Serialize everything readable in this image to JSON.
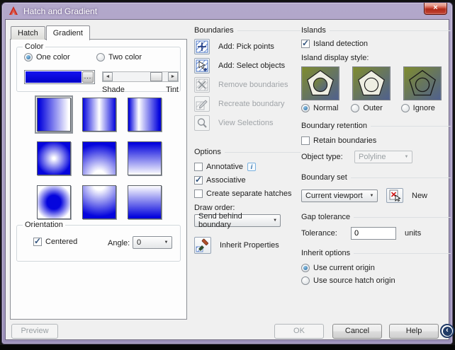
{
  "window": {
    "title": "Hatch and Gradient",
    "close_glyph": "×"
  },
  "tabs": {
    "hatch": "Hatch",
    "gradient": "Gradient"
  },
  "color": {
    "group_title": "Color",
    "one_color_label": "One color",
    "two_color_label": "Two color",
    "swatch_color": "#0a0ae0",
    "browse_label": "...",
    "shade_label": "Shade",
    "tint_label": "Tint"
  },
  "swatches": {
    "selected": "linear",
    "items": [
      {
        "name": "linear"
      },
      {
        "name": "cylinder"
      },
      {
        "name": "inverted-cylinder"
      },
      {
        "name": "spherical"
      },
      {
        "name": "hemispherical"
      },
      {
        "name": "curved"
      },
      {
        "name": "inverted-spherical"
      },
      {
        "name": "inverted-hemispherical"
      },
      {
        "name": "inverted-curved"
      }
    ]
  },
  "orientation": {
    "group_title": "Orientation",
    "centered_label": "Centered",
    "centered_checked": true,
    "angle_label": "Angle:",
    "angle_value": "0"
  },
  "preview": {
    "label": "Preview",
    "enabled": false
  },
  "boundaries": {
    "title": "Boundaries",
    "buttons": [
      {
        "label": "Add: Pick points",
        "enabled": true
      },
      {
        "label": "Add: Select objects",
        "enabled": true
      },
      {
        "label": "Remove boundaries",
        "enabled": false
      },
      {
        "label": "Recreate boundary",
        "enabled": false
      },
      {
        "label": "View Selections",
        "enabled": false
      }
    ]
  },
  "options": {
    "title": "Options",
    "annotative_label": "Annotative",
    "annotative_checked": false,
    "info_glyph": "i",
    "associative_label": "Associative",
    "associative_checked": true,
    "separate_label": "Create separate hatches",
    "separate_checked": false,
    "draw_order_label": "Draw order:",
    "draw_order_value": "Send behind boundary",
    "inherit_label": "Inherit Properties"
  },
  "islands": {
    "title": "Islands",
    "detection_label": "Island detection",
    "detection_checked": true,
    "display_style_label": "Island display style:",
    "styles": [
      {
        "label": "Normal",
        "selected": true
      },
      {
        "label": "Outer",
        "selected": false
      },
      {
        "label": "Ignore",
        "selected": false
      }
    ]
  },
  "boundary_retention": {
    "title": "Boundary retention",
    "retain_label": "Retain boundaries",
    "retain_checked": false,
    "object_type_label": "Object type:",
    "object_type_value": "Polyline"
  },
  "boundary_set": {
    "title": "Boundary set",
    "value": "Current viewport",
    "new_label": "New"
  },
  "gap_tolerance": {
    "title": "Gap tolerance",
    "tolerance_label": "Tolerance:",
    "tolerance_value": "0",
    "units_label": "units"
  },
  "inherit_options": {
    "title": "Inherit options",
    "use_current_label": "Use current origin",
    "use_current_selected": true,
    "use_source_label": "Use source hatch origin",
    "use_source_selected": false
  },
  "footer": {
    "ok": "OK",
    "cancel": "Cancel",
    "help": "Help"
  },
  "colors": {
    "titlebar": "#a89cc4",
    "gradient_blue": "#0a0ae0",
    "island_olive": "#7f8c2e",
    "island_slate": "#4f608e",
    "close_red": "#c0392b"
  }
}
